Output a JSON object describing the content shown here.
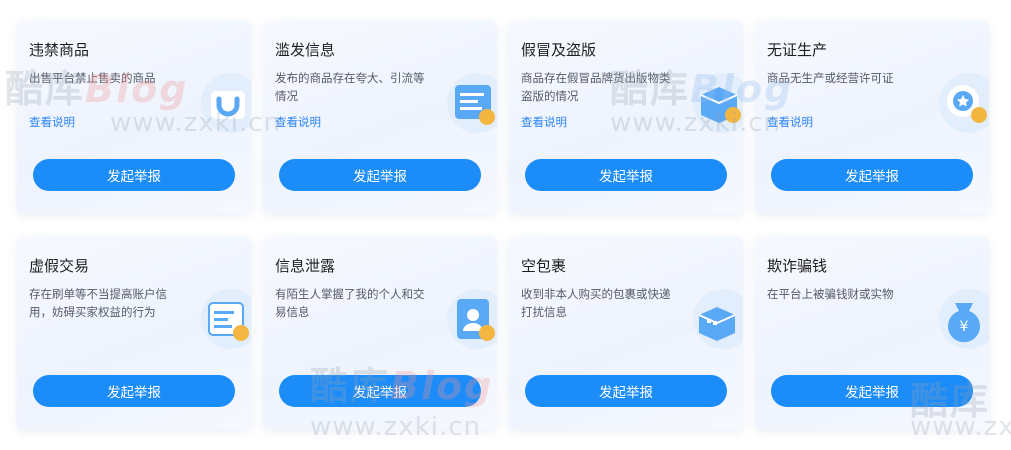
{
  "cards": [
    {
      "title": "违禁商品",
      "desc": "出售平台禁止售卖的商品",
      "link": "查看说明",
      "button": "发起举报",
      "icon": "bag-icon"
    },
    {
      "title": "滥发信息",
      "desc": "发布的商品存在夸大、引流等情况",
      "link": "查看说明",
      "button": "发起举报",
      "icon": "document-icon"
    },
    {
      "title": "假冒及盗版",
      "desc": "商品存在假冒品牌货出版物类盗版的情况",
      "link": "查看说明",
      "button": "发起举报",
      "icon": "box-icon"
    },
    {
      "title": "无证生产",
      "desc": "商品无生产或经营许可证",
      "link": "查看说明",
      "button": "发起举报",
      "icon": "certificate-icon"
    },
    {
      "title": "虚假交易",
      "desc": "存在刷单等不当提高账户信用，妨碍买家权益的行为",
      "link": "",
      "button": "发起举报",
      "icon": "receipt-icon"
    },
    {
      "title": "信息泄露",
      "desc": "有陌生人掌握了我的个人和交易信息",
      "link": "",
      "button": "发起举报",
      "icon": "id-card-icon"
    },
    {
      "title": "空包裹",
      "desc": "收到非本人购买的包裹或快递打扰信息",
      "link": "",
      "button": "发起举报",
      "icon": "empty-package-icon"
    },
    {
      "title": "欺诈骗钱",
      "desc": "在平台上被骗钱财或实物",
      "link": "",
      "button": "发起举报",
      "icon": "money-bag-icon"
    }
  ],
  "watermark": {
    "brand": "酷库",
    "blog": "Blog",
    "url": "www.zxki.cn"
  },
  "colors": {
    "primary": "#1c8cf8",
    "link": "#2a84f5",
    "icon_blue": "#5aa9f7",
    "icon_badge": "#f3b640"
  }
}
